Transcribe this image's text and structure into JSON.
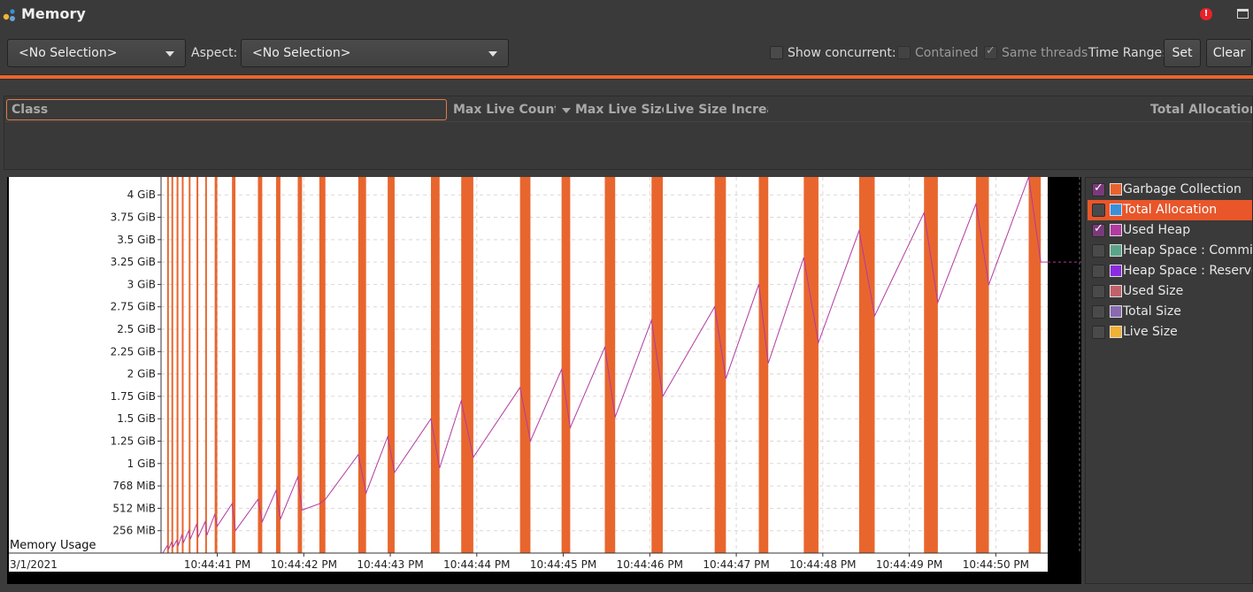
{
  "window": {
    "title": "Memory"
  },
  "toolbar": {
    "selection_value": "<No Selection>",
    "aspect_label": "Aspect:",
    "aspect_value": "<No Selection>",
    "show_concurrent_label": "Show concurrent:",
    "show_concurrent_checked": false,
    "contained_label": "Contained",
    "contained_checked": false,
    "same_threads_label": "Same threads",
    "same_threads_checked": true,
    "time_range_label": "Time Range:",
    "set_label": "Set",
    "clear_label": "Clear"
  },
  "table": {
    "filter_placeholder": "Class",
    "columns": [
      "Max Live Count",
      "Max Live Size",
      "Live Size Increas",
      "Total Allocation"
    ]
  },
  "legend": {
    "items": [
      {
        "label": "Garbage Collection",
        "checked": true,
        "color": "#e8622e",
        "selected": false
      },
      {
        "label": "Total Allocation",
        "checked": false,
        "color": "#3b8fd9",
        "selected": true
      },
      {
        "label": "Used Heap",
        "checked": true,
        "color": "#b23aa0",
        "selected": false
      },
      {
        "label": "Heap Space : Committed",
        "checked": false,
        "color": "#5aa58a",
        "selected": false
      },
      {
        "label": "Heap Space : Reserved",
        "checked": false,
        "color": "#8a2be2",
        "selected": false
      },
      {
        "label": "Used Size",
        "checked": false,
        "color": "#c2606a",
        "selected": false
      },
      {
        "label": "Total Size",
        "checked": false,
        "color": "#8a6ab0",
        "selected": false
      },
      {
        "label": "Live Size",
        "checked": false,
        "color": "#f0b030",
        "selected": false
      }
    ]
  },
  "chart_data": {
    "type": "line",
    "title": "",
    "ylabel": "Memory Usage",
    "date_label": "3/1/2021",
    "y_ticks": [
      "256 MiB",
      "512 MiB",
      "768 MiB",
      "1 GiB",
      "1.25 GiB",
      "1.5 GiB",
      "1.75 GiB",
      "2 GiB",
      "2.25 GiB",
      "2.5 GiB",
      "2.75 GiB",
      "3 GiB",
      "3.25 GiB",
      "3.5 GiB",
      "3.75 GiB",
      "4 GiB"
    ],
    "y_tick_values_gib": [
      0.25,
      0.5,
      0.75,
      1,
      1.25,
      1.5,
      1.75,
      2,
      2.25,
      2.5,
      2.75,
      3,
      3.25,
      3.5,
      3.75,
      4
    ],
    "ylim_gib": [
      0,
      4.2
    ],
    "x_ticks": [
      "10:44:41 PM",
      "10:44:42 PM",
      "10:44:43 PM",
      "10:44:44 PM",
      "10:44:45 PM",
      "10:44:46 PM",
      "10:44:47 PM",
      "10:44:48 PM",
      "10:44:49 PM",
      "10:44:50 PM"
    ],
    "x_tick_seconds": [
      41,
      42,
      43,
      44,
      45,
      46,
      47,
      48,
      49,
      50
    ],
    "xlim_seconds": [
      40.35,
      50.6
    ],
    "grid": true,
    "gc_color": "#e8662e",
    "heap_color": "#b23aa0",
    "garbage_collection_events": [
      [
        40.42,
        40.44
      ],
      [
        40.47,
        40.49
      ],
      [
        40.53,
        40.55
      ],
      [
        40.59,
        40.61
      ],
      [
        40.67,
        40.69
      ],
      [
        40.76,
        40.78
      ],
      [
        40.86,
        40.88
      ],
      [
        40.97,
        41.0
      ],
      [
        41.17,
        41.21
      ],
      [
        41.47,
        41.52
      ],
      [
        41.68,
        41.73
      ],
      [
        41.93,
        41.98
      ],
      [
        42.18,
        42.25
      ],
      [
        42.63,
        42.72
      ],
      [
        42.97,
        43.05
      ],
      [
        43.47,
        43.57
      ],
      [
        43.82,
        43.96
      ],
      [
        44.5,
        44.62
      ],
      [
        44.98,
        45.08
      ],
      [
        45.48,
        45.6
      ],
      [
        46.02,
        46.15
      ],
      [
        46.75,
        46.88
      ],
      [
        47.26,
        47.37
      ],
      [
        47.78,
        47.95
      ],
      [
        48.42,
        48.6
      ],
      [
        49.17,
        49.33
      ],
      [
        49.77,
        49.92
      ],
      [
        50.38,
        50.52
      ]
    ],
    "series": [
      {
        "name": "Used Heap",
        "unit": "GiB",
        "x": [
          40.37,
          40.42,
          40.44,
          40.47,
          40.49,
          40.53,
          40.55,
          40.59,
          40.61,
          40.67,
          40.69,
          40.76,
          40.78,
          40.86,
          40.88,
          40.97,
          41.0,
          41.17,
          41.21,
          41.47,
          41.52,
          41.68,
          41.73,
          41.93,
          41.98,
          42.18,
          42.25,
          42.63,
          42.72,
          42.97,
          43.05,
          43.47,
          43.57,
          43.82,
          43.96,
          44.5,
          44.62,
          44.98,
          45.08,
          45.48,
          45.6,
          46.02,
          46.15,
          46.75,
          46.88,
          47.26,
          47.37,
          47.78,
          47.95,
          48.42,
          48.6,
          49.17,
          49.33,
          49.77,
          49.92,
          50.38,
          50.52,
          50.6
        ],
        "values": [
          0.0,
          0.08,
          0.05,
          0.12,
          0.07,
          0.14,
          0.09,
          0.2,
          0.12,
          0.25,
          0.16,
          0.32,
          0.18,
          0.35,
          0.2,
          0.43,
          0.3,
          0.55,
          0.25,
          0.6,
          0.35,
          0.7,
          0.38,
          0.85,
          0.48,
          0.55,
          0.6,
          1.1,
          0.67,
          1.3,
          0.9,
          1.5,
          0.95,
          1.7,
          1.07,
          1.85,
          1.25,
          2.05,
          1.4,
          2.3,
          1.52,
          2.6,
          1.75,
          2.75,
          1.95,
          3.0,
          2.12,
          3.3,
          2.35,
          3.6,
          2.65,
          3.8,
          2.8,
          3.9,
          3.0,
          4.2,
          3.25,
          3.25
        ]
      }
    ]
  }
}
